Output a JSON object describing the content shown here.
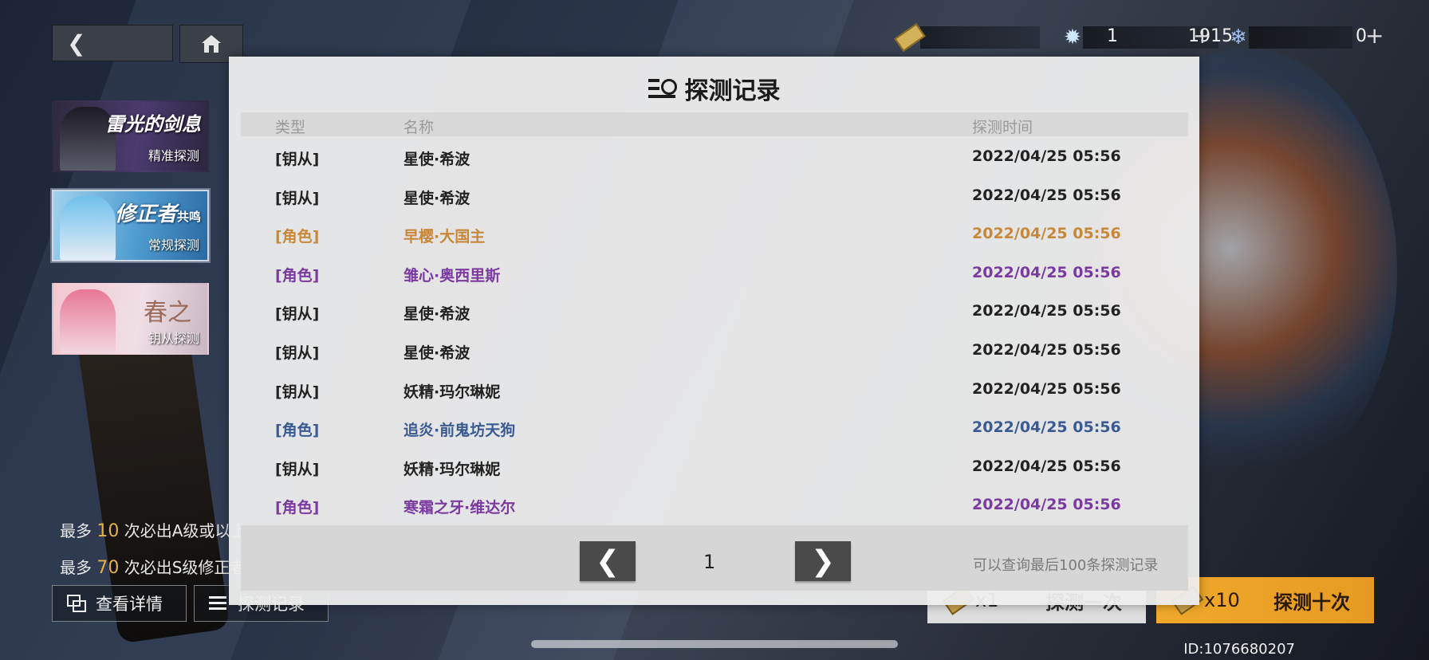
{
  "resources": [
    {
      "icon": "ticket-icon",
      "value": "1",
      "has_plus": false
    },
    {
      "icon": "crystal-icon",
      "value": "1915",
      "has_plus": true,
      "plus": "+"
    },
    {
      "icon": "snowflake-gem-icon",
      "value": "0",
      "has_plus": true,
      "plus": "+"
    }
  ],
  "banners": [
    {
      "title": "雷光的剑息",
      "sub": "精准探测"
    },
    {
      "title": "修正者",
      "title_small": "共鸣",
      "sub": "常规探测"
    },
    {
      "title": "春之",
      "sub": "钥从探测"
    }
  ],
  "pity": {
    "line1_prefix": "最多",
    "line1_num": "10",
    "line1_suffix": "次必出A级或以上...",
    "line2_prefix": "最多",
    "line2_num": "70",
    "line2_suffix": "次必出S级修正者"
  },
  "bottom_buttons": {
    "detail": "查看详情",
    "record": "探测记录",
    "pull1_count": "x1",
    "pull1_label": "探测一次",
    "pull10_count": "x10",
    "pull10_label": "探测十次"
  },
  "uid": "ID:1076680207",
  "modal": {
    "title": "探测记录",
    "headers": {
      "type": "类型",
      "name": "名称",
      "time": "探测时间"
    },
    "rows": [
      {
        "type": "[钥从]",
        "name": "星使·希波",
        "time": "2022/04/25 05:56",
        "rarity": "normal"
      },
      {
        "type": "[钥从]",
        "name": "星使·希波",
        "time": "2022/04/25 05:56",
        "rarity": "normal"
      },
      {
        "type": "[角色]",
        "name": "早樱·大国主",
        "time": "2022/04/25 05:56",
        "rarity": "orange"
      },
      {
        "type": "[角色]",
        "name": "雏心·奥西里斯",
        "time": "2022/04/25 05:56",
        "rarity": "purple"
      },
      {
        "type": "[钥从]",
        "name": "星使·希波",
        "time": "2022/04/25 05:56",
        "rarity": "normal"
      },
      {
        "type": "[钥从]",
        "name": "星使·希波",
        "time": "2022/04/25 05:56",
        "rarity": "normal"
      },
      {
        "type": "[钥从]",
        "name": "妖精·玛尔琳妮",
        "time": "2022/04/25 05:56",
        "rarity": "normal"
      },
      {
        "type": "[角色]",
        "name": "追炎·前鬼坊天狗",
        "time": "2022/04/25 05:56",
        "rarity": "blue"
      },
      {
        "type": "[钥从]",
        "name": "妖精·玛尔琳妮",
        "time": "2022/04/25 05:56",
        "rarity": "normal"
      },
      {
        "type": "[角色]",
        "name": "寒霜之牙·维达尔",
        "time": "2022/04/25 05:56",
        "rarity": "purple"
      }
    ],
    "page": "1",
    "prev": "❮",
    "next": "❯",
    "footnote": "可以查询最后100条探测记录"
  },
  "colors": {
    "orange": "#c8883a",
    "purple": "#7a3aa0",
    "blue": "#3a5a94",
    "gold": "#e4b148"
  }
}
